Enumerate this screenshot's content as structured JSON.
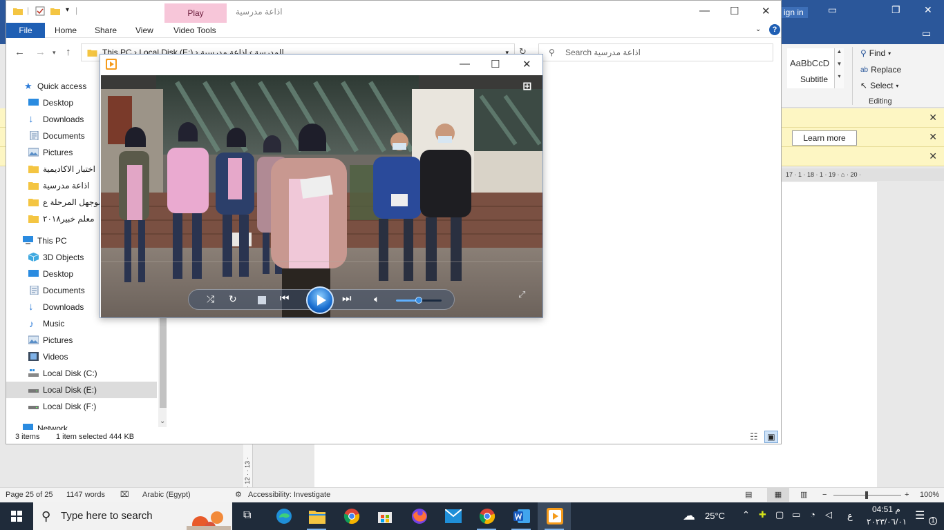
{
  "word": {
    "sign_in": "ign in",
    "styles": {
      "sample": "AaBbCcD",
      "name": "Subtitle"
    },
    "editing": {
      "find": "Find",
      "replace": "Replace",
      "select": "Select",
      "group_label": "Editing"
    },
    "learn_more": "Learn more",
    "ruler_text": "17 · 1 · 18 · 1 · 19 · ⌂ · 20 ·",
    "vertical_ruler": "· 12 · · 13 ·",
    "status": {
      "page": "Page 25 of 25",
      "words": "1147 words",
      "language": "Arabic (Egypt)",
      "accessibility": "Accessibility: Investigate",
      "zoom": "100%"
    }
  },
  "explorer": {
    "play_tab": "Play",
    "window_title": "اذاعة مدرسية",
    "tabs": {
      "file": "File",
      "home": "Home",
      "share": "Share",
      "view": "View",
      "video_tools": "Video Tools"
    },
    "address": "This PC  ›  Local Disk (E:)  ›  المدرسة  ›  اذاعة مدرسية",
    "search_placeholder": "Search اذاعة مدرسية",
    "nav": {
      "quick_access": "Quick access",
      "qa_items": [
        "Desktop",
        "Downloads",
        "Documents",
        "Pictures",
        "اختبار الاكاديمية",
        "اذاعة مدرسية",
        "ابوجهل المرحلة ع",
        "معلم خبير٢٠١٨"
      ],
      "this_pc": "This PC",
      "pc_items": [
        "3D Objects",
        "Desktop",
        "Documents",
        "Downloads",
        "Music",
        "Pictures",
        "Videos",
        "Local Disk (C:)",
        "Local Disk (E:)",
        "Local Disk (F:)"
      ],
      "network": "Network"
    },
    "status": {
      "items": "3 items",
      "selected": "1 item selected  444 KB"
    }
  },
  "player": {
    "volume_level": 0.5
  },
  "taskbar": {
    "search_placeholder": "Type here to search",
    "weather": "25°C",
    "lang": "ع",
    "time": "م 04:51",
    "date": "٢٠٢٣/٠٦/٠١",
    "notification_count": "1"
  }
}
